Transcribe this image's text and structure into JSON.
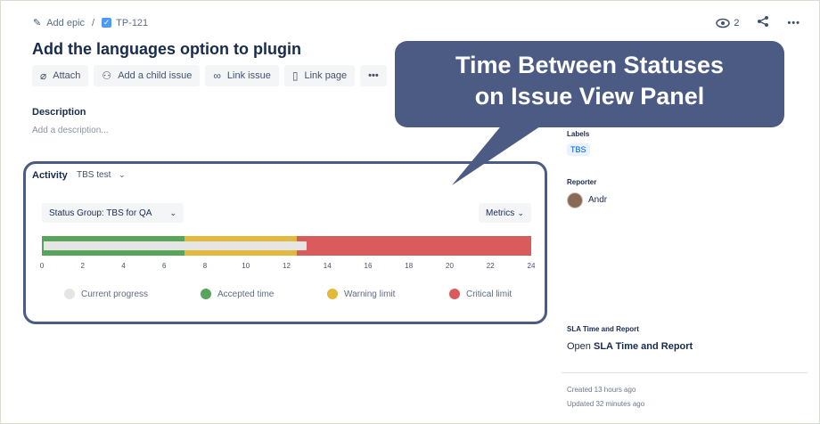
{
  "breadcrumb": {
    "epic": "Add epic",
    "separator": "/",
    "issue_key": "TP-121"
  },
  "header": {
    "watchers": "2"
  },
  "issue": {
    "title": "Add the languages option to plugin"
  },
  "toolbar": {
    "attach": "Attach",
    "child": "Add a child issue",
    "link": "Link issue",
    "page": "Link page",
    "more": "•••"
  },
  "description": {
    "label": "Description",
    "placeholder": "Add a description..."
  },
  "activity": {
    "label": "Activity",
    "filter": "TBS test"
  },
  "panel": {
    "status_group": "Status Group: TBS for QA",
    "metrics": "Metrics",
    "bar": {
      "max": 24,
      "accepted": 7,
      "warning": 12.5,
      "current_progress": 13,
      "colors": {
        "accepted": "#57a55a",
        "warning": "#e2b93b",
        "critical": "#d95b5b",
        "progress": "#e5e5e5"
      }
    },
    "ticks": [
      "0",
      "2",
      "4",
      "6",
      "8",
      "10",
      "12",
      "14",
      "16",
      "18",
      "20",
      "22",
      "24"
    ],
    "legend": [
      "Current progress",
      "Accepted time",
      "Warning limit",
      "Critical limit"
    ]
  },
  "callout": {
    "line1": "Time Between Statuses",
    "line2": "on Issue View Panel"
  },
  "sidebar": {
    "labels_title": "Labels",
    "label_tag": "TBS",
    "reporter_title": "Reporter",
    "reporter_name": "Andr",
    "sla_title": "SLA Time and Report",
    "sla_open": "Open",
    "sla_link": "SLA Time and Report",
    "created": "Created 13 hours ago",
    "updated": "Updated 32 minutes ago"
  }
}
